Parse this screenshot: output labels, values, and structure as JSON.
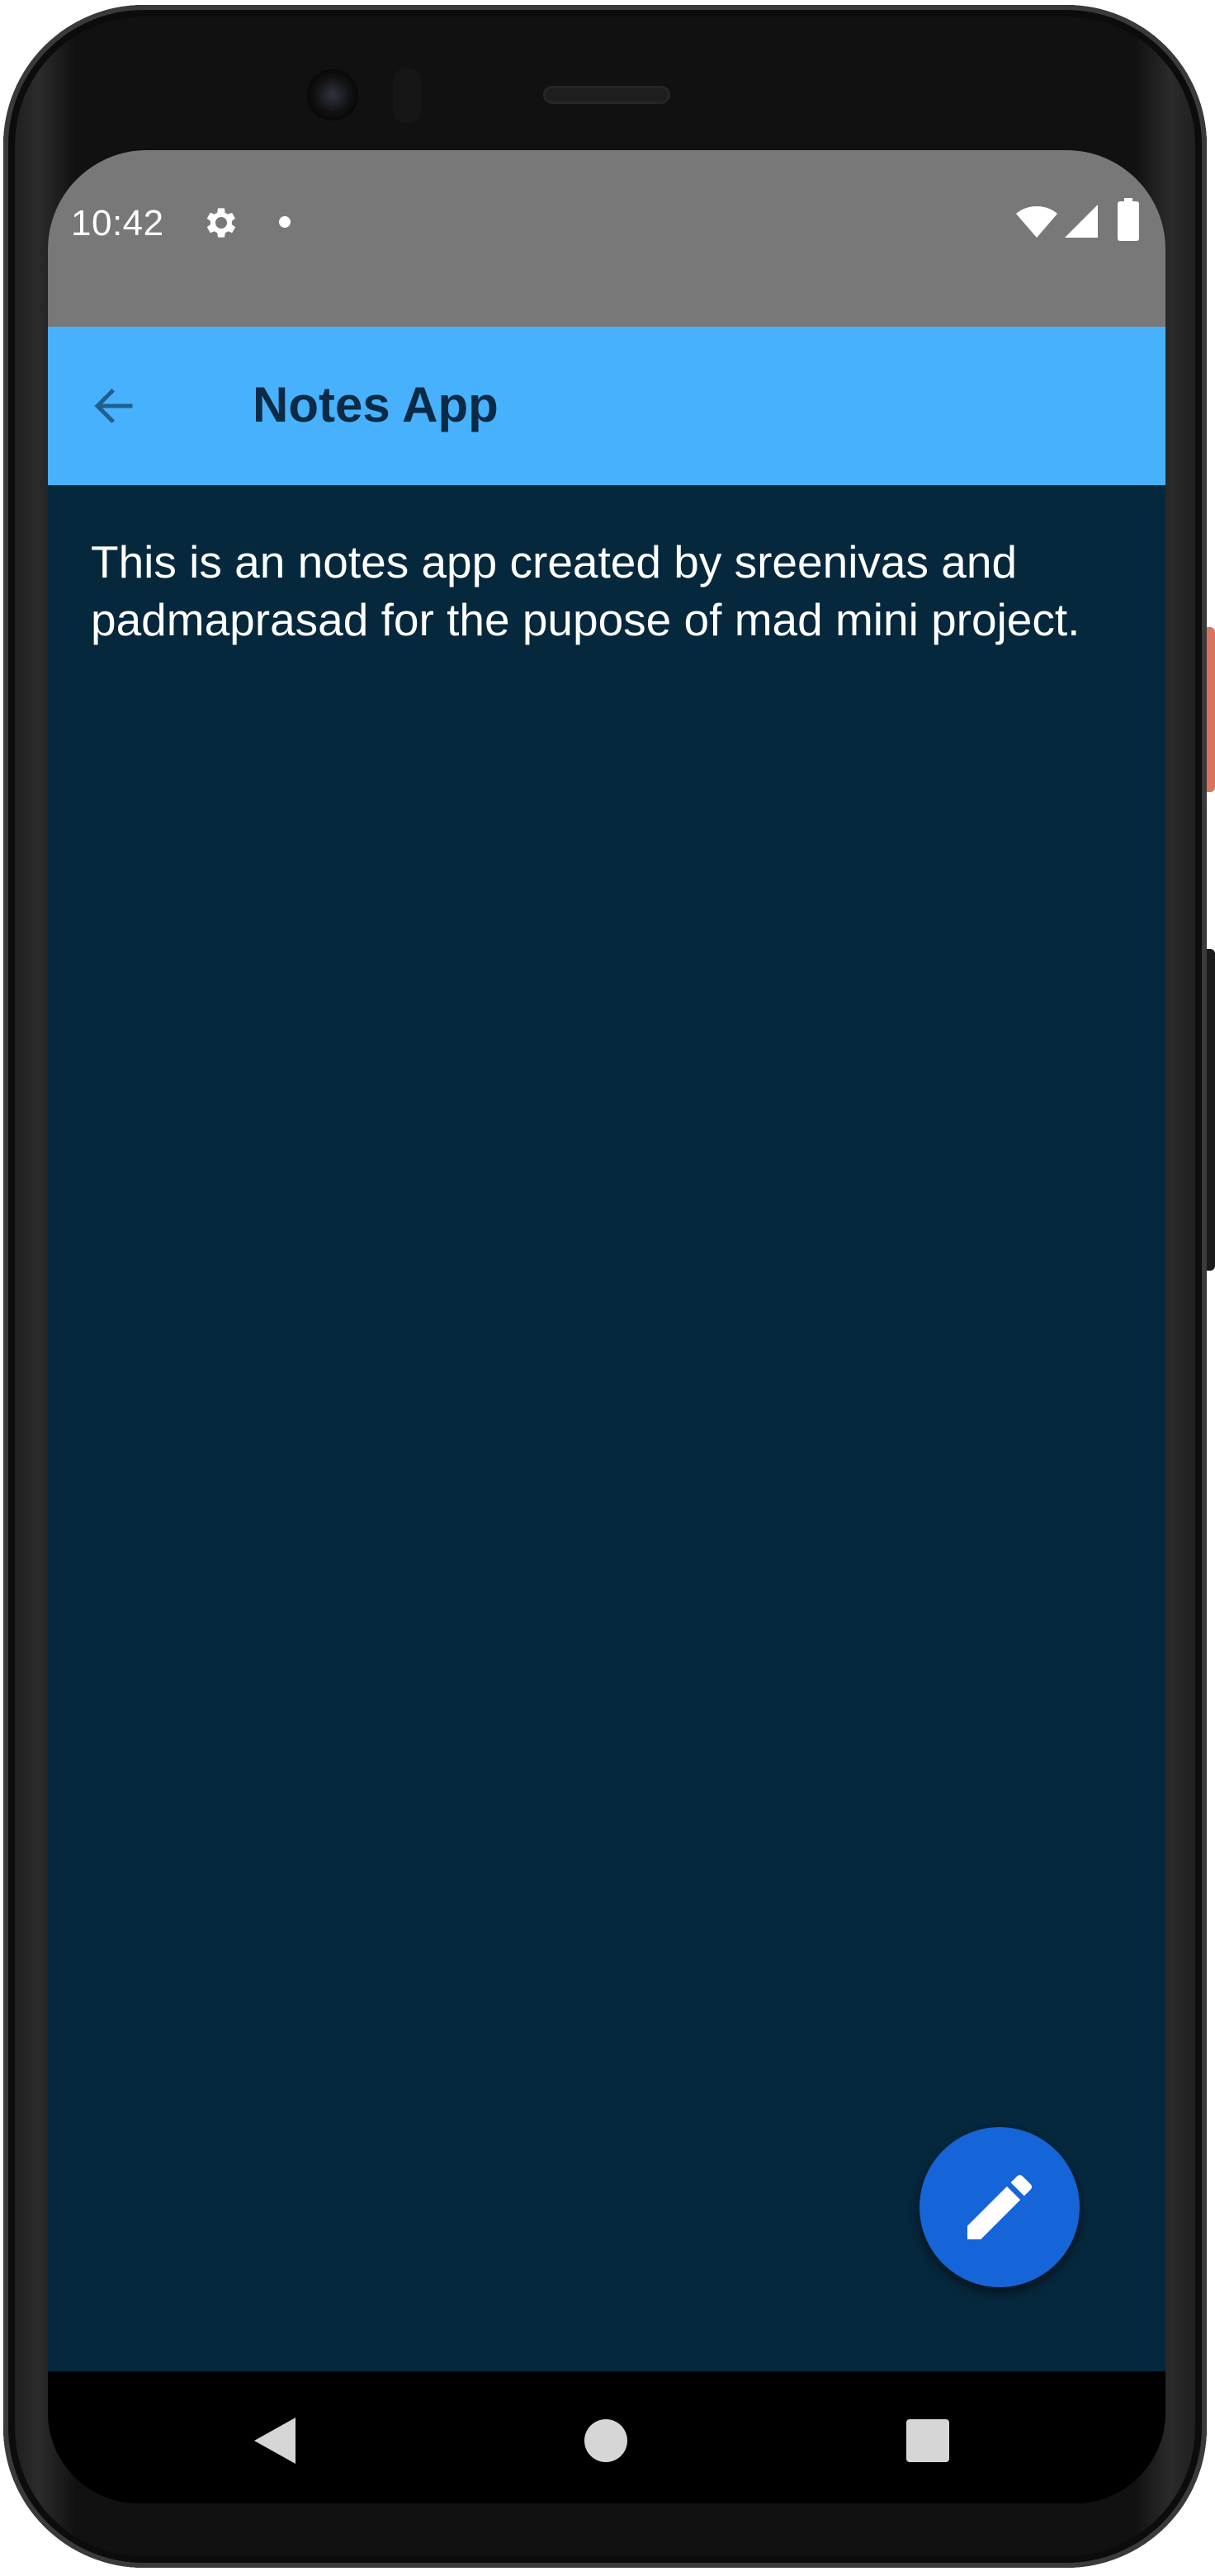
{
  "status_bar": {
    "time": "10:42",
    "icons": [
      "gear-icon",
      "notification-dot-icon",
      "wifi-icon",
      "signal-icon",
      "battery-icon"
    ]
  },
  "app_bar": {
    "back_icon": "arrow-left-icon",
    "title": "Notes App"
  },
  "note": {
    "body": "This is an notes app created by sreenivas and padmaprasad for the pupose of mad mini project."
  },
  "fab": {
    "icon": "pencil-icon"
  },
  "nav_bar": {
    "icons": [
      "nav-back-icon",
      "nav-home-icon",
      "nav-recents-icon"
    ]
  },
  "colors": {
    "app_bar": "#48b1fe",
    "content_background": "#06283d",
    "status_bar": "#787878",
    "title_text": "#0b2a45",
    "fab": "#1565d8"
  }
}
